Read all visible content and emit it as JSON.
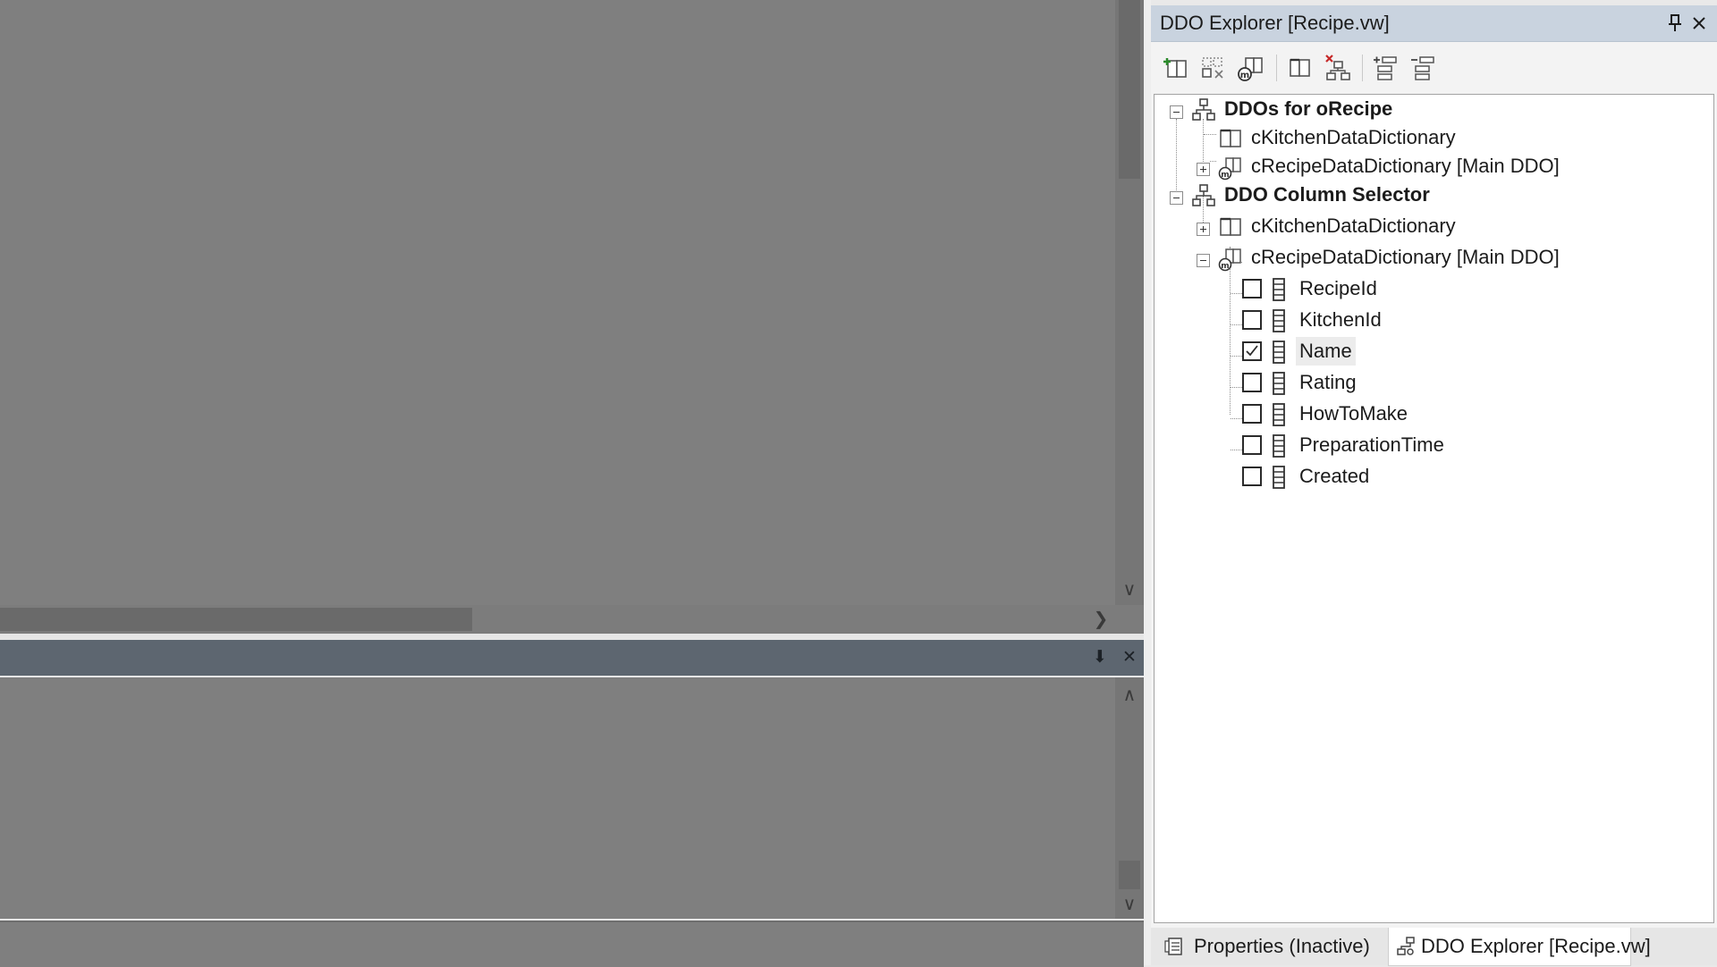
{
  "left_area": {
    "canvas_scroll": {
      "down_arrow_icon": "chevron-down",
      "right_arrow_icon": "chevron-right"
    },
    "bottom_panel": {
      "pin_icon": "pin",
      "close_icon": "close",
      "up_arrow_icon": "chevron-up",
      "down_arrow_icon": "chevron-down"
    }
  },
  "dock": {
    "title": "DDO Explorer [Recipe.vw]",
    "pin_glyph": "📌",
    "close_glyph": "✕",
    "toolbar": [
      {
        "icon": "add-ddo-icon"
      },
      {
        "icon": "remove-ddo-icon"
      },
      {
        "icon": "set-main-ddo-icon"
      },
      {
        "icon": "view-ddo-icon"
      },
      {
        "icon": "delete-structure-icon"
      },
      {
        "icon": "expand-all-icon"
      },
      {
        "icon": "collapse-all-icon"
      }
    ],
    "tree": {
      "groups": [
        {
          "label": "DDOs for oRecipe",
          "children": [
            {
              "label": "cKitchenDataDictionary"
            },
            {
              "label": "cRecipeDataDictionary [Main DDO]"
            }
          ]
        },
        {
          "label": "DDO Column Selector",
          "children": [
            {
              "label": "cKitchenDataDictionary"
            },
            {
              "label": "cRecipeDataDictionary [Main DDO]",
              "columns": [
                {
                  "label": "RecipeId",
                  "checked": false
                },
                {
                  "label": "KitchenId",
                  "checked": false
                },
                {
                  "label": "Name",
                  "checked": true
                },
                {
                  "label": "Rating",
                  "checked": false
                },
                {
                  "label": "HowToMake",
                  "checked": false
                },
                {
                  "label": "PreparationTime",
                  "checked": false
                },
                {
                  "label": "Created",
                  "checked": false
                }
              ]
            }
          ]
        }
      ]
    },
    "tabs": [
      {
        "label": "Properties (Inactive)",
        "active": false
      },
      {
        "label": "DDO Explorer [Recipe.vw]",
        "active": true
      }
    ]
  }
}
